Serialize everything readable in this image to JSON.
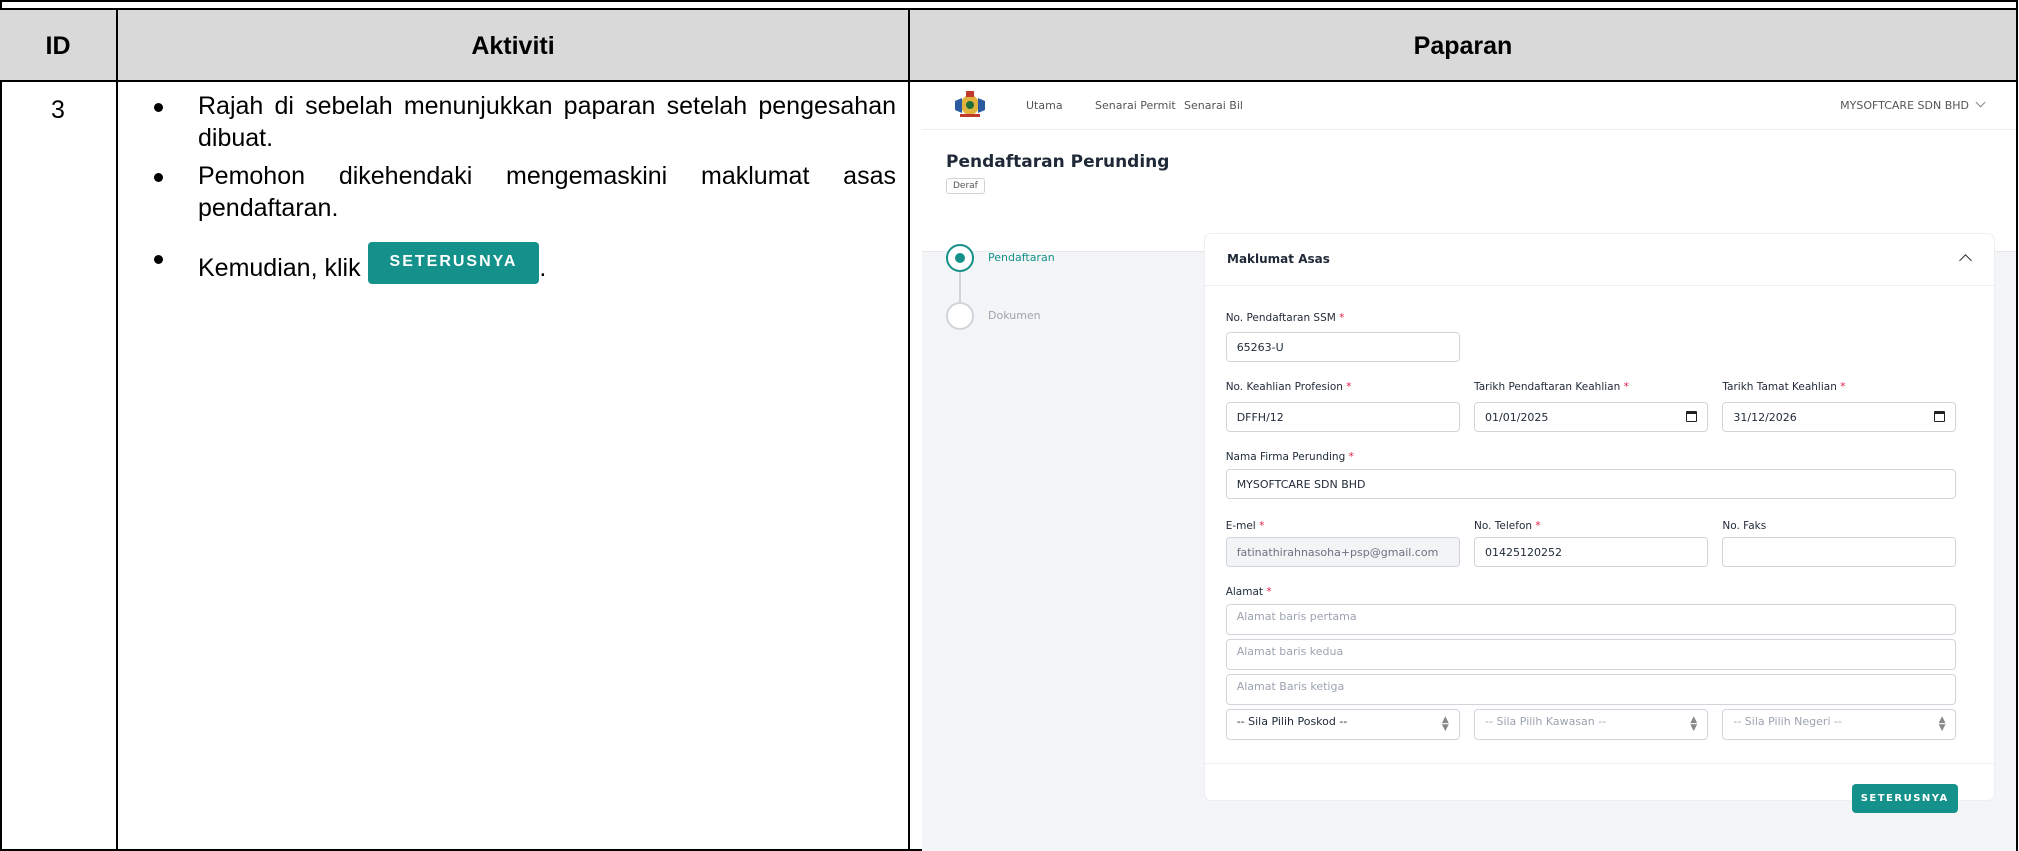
{
  "table": {
    "headers": {
      "id": "ID",
      "aktiviti": "Aktiviti",
      "paparan": "Paparan"
    },
    "row_id": "3",
    "bullets": [
      "Rajah di sebelah menunjukkan paparan setelah pengesahan dibuat.",
      "Pemohon dikehendaki mengemaskini maklumat asas pendaftaran.",
      "Kemudian, klik"
    ],
    "inline_button": "SETERUSNYA",
    "trailing_period": "."
  },
  "app": {
    "nav": {
      "links": [
        "Utama",
        "Senarai Permit",
        "Senarai Bil"
      ],
      "user": "MYSOFTCARE SDN BHD"
    },
    "page_title": "Pendaftaran Perunding",
    "status_badge": "Deraf",
    "steps": [
      "Pendaftaran",
      "Dokumen"
    ],
    "section_title": "Maklumat Asas",
    "fields": {
      "ssm": {
        "label": "No. Pendaftaran SSM",
        "value": "65263-U"
      },
      "keahlian": {
        "label": "No. Keahlian Profesion",
        "value": "DFFH/12"
      },
      "tarikh_daftar": {
        "label": "Tarikh Pendaftaran Keahlian",
        "value": "01/01/2025"
      },
      "tarikh_tamat": {
        "label": "Tarikh Tamat Keahlian",
        "value": "31/12/2026"
      },
      "firma": {
        "label": "Nama Firma Perunding",
        "value": "MYSOFTCARE SDN BHD"
      },
      "emel": {
        "label": "E-mel",
        "value": "fatinathirahnasoha+psp@gmail.com"
      },
      "telefon": {
        "label": "No. Telefon",
        "value": "01425120252"
      },
      "faks": {
        "label": "No. Faks",
        "value": ""
      },
      "alamat": {
        "label": "Alamat",
        "placeholders": [
          "Alamat baris pertama",
          "Alamat baris kedua",
          "Alamat Baris ketiga"
        ]
      },
      "poskod": "-- Sila Pilih Poskod --",
      "kawasan": "-- Sila Pilih Kawasan --",
      "negeri": "-- Sila Pilih Negeri --"
    },
    "next_button": "SETERUSNYA",
    "colors": {
      "primary": "#14918a",
      "required": "#e11d48"
    }
  }
}
